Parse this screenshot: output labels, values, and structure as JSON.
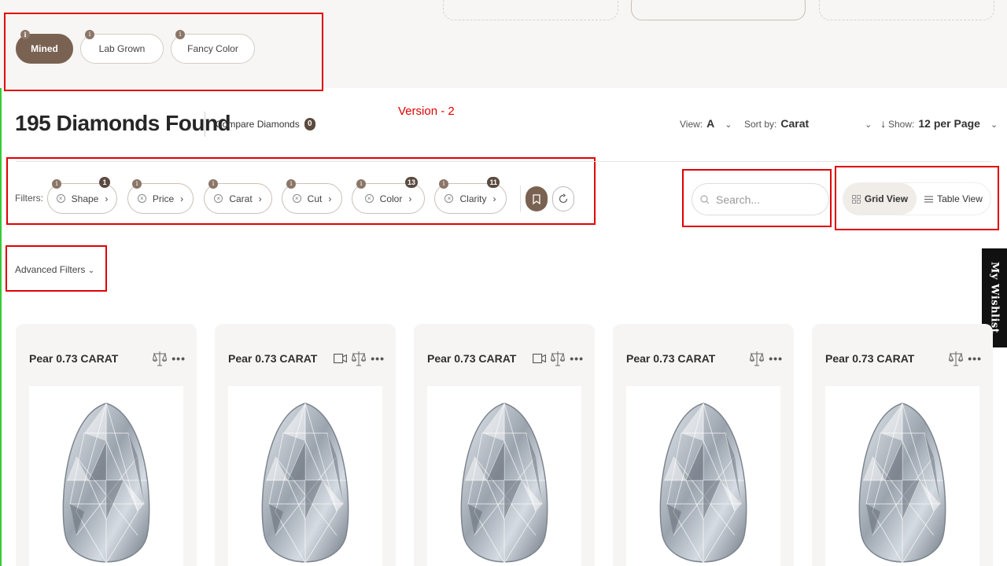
{
  "origin_tabs": [
    {
      "label": "Mined",
      "active": true
    },
    {
      "label": "Lab Grown",
      "active": false
    },
    {
      "label": "Fancy Color",
      "active": false
    }
  ],
  "annotation": {
    "version_label": "Version - 2"
  },
  "results": {
    "title": "195 Diamonds Found",
    "compare_label": "Compare Diamonds",
    "compare_count": "0"
  },
  "controls": {
    "view_label": "View:",
    "view_value": "A",
    "sort_label": "Sort by:",
    "sort_value": "Carat",
    "show_label": "Show:",
    "show_value": "12 per Page"
  },
  "filters": {
    "label": "Filters:",
    "items": [
      {
        "label": "Shape",
        "count": "1"
      },
      {
        "label": "Price",
        "count": ""
      },
      {
        "label": "Carat",
        "count": ""
      },
      {
        "label": "Cut",
        "count": ""
      },
      {
        "label": "Color",
        "count": "13"
      },
      {
        "label": "Clarity",
        "count": "11"
      }
    ]
  },
  "search": {
    "placeholder": "Search..."
  },
  "view_toggle": {
    "grid_label": "Grid View",
    "table_label": "Table View",
    "active": "grid"
  },
  "advanced_filters_label": "Advanced Filters",
  "wishlist_label": "My Wishlist",
  "products": [
    {
      "title": "Pear 0.73 CARAT",
      "has_video": false
    },
    {
      "title": "Pear 0.73 CARAT",
      "has_video": true
    },
    {
      "title": "Pear 0.73 CARAT",
      "has_video": true
    },
    {
      "title": "Pear 0.73 CARAT",
      "has_video": false
    },
    {
      "title": "Pear 0.73 CARAT",
      "has_video": false
    }
  ],
  "colors": {
    "accent": "#7a6252",
    "badge": "#5b4a3f",
    "annotation": "#e00000"
  },
  "icons": {
    "info": "info-icon",
    "remove": "remove-filter-icon",
    "bookmark": "bookmark-icon",
    "reset": "reset-icon",
    "search": "search-icon",
    "grid": "grid-icon",
    "list": "list-icon",
    "video": "video-icon",
    "compare": "compare-scale-icon",
    "more": "more-icon"
  }
}
